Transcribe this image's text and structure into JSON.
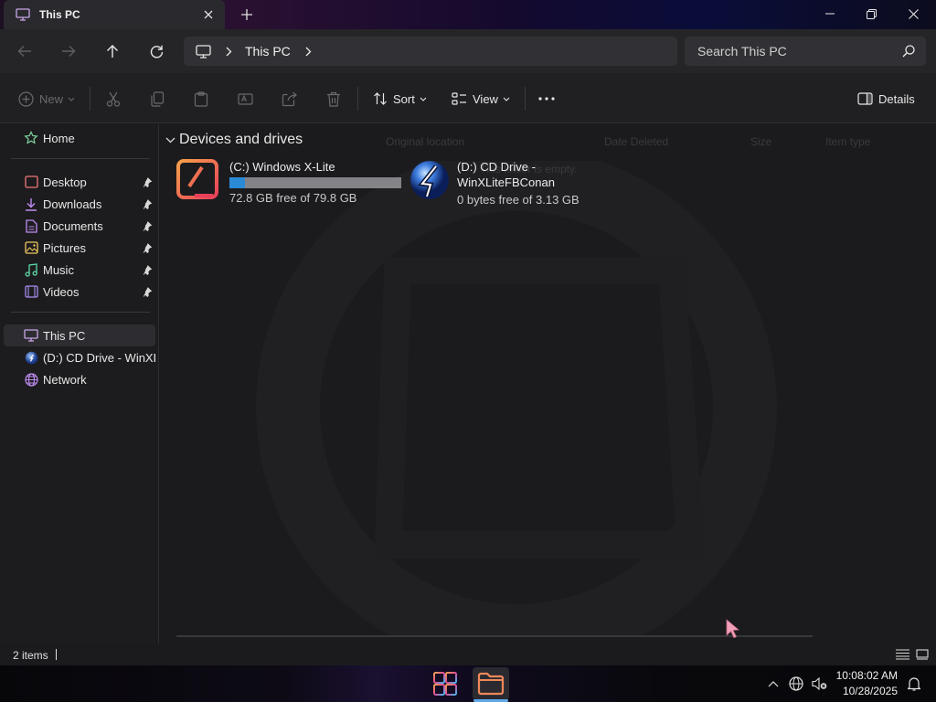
{
  "window": {
    "tab_title": "This PC",
    "tab_icon": "monitor-icon",
    "colors": {
      "accent": "#2b8ad6",
      "background": "#1b1b1d"
    }
  },
  "address": {
    "crumbs": [
      "This PC"
    ],
    "search_placeholder": "Search This PC"
  },
  "toolbar": {
    "new_label": "New",
    "sort_label": "Sort",
    "view_label": "View",
    "details_label": "Details"
  },
  "sidebar": {
    "home": {
      "label": "Home",
      "icon": "home-icon"
    },
    "pinned": [
      {
        "label": "Desktop",
        "icon": "desktop-icon",
        "pinned": true
      },
      {
        "label": "Downloads",
        "icon": "downloads-icon",
        "pinned": true
      },
      {
        "label": "Documents",
        "icon": "documents-icon",
        "pinned": true
      },
      {
        "label": "Pictures",
        "icon": "pictures-icon",
        "pinned": true
      },
      {
        "label": "Music",
        "icon": "music-icon",
        "pinned": true
      },
      {
        "label": "Videos",
        "icon": "videos-icon",
        "pinned": true
      }
    ],
    "locations": [
      {
        "label": "This PC",
        "icon": "this-pc-icon",
        "selected": true
      },
      {
        "label": "(D:) CD Drive - WinXLiteFBConan",
        "icon": "cd-drive-icon"
      },
      {
        "label": "Network",
        "icon": "network-icon"
      }
    ]
  },
  "content": {
    "group_header": "Devices and drives",
    "background_columns": [
      "Original location",
      "Date Deleted",
      "Size",
      "Item type"
    ],
    "background_empty_text": "This folder is empty.",
    "drives": [
      {
        "label": "(C:) Windows X-Lite",
        "free_text": "72.8 GB free of 79.8 GB",
        "used_fraction": 0.088,
        "icon": "windows-x-lite-drive-icon"
      },
      {
        "label_line1": "(D:) CD Drive -",
        "label_line2": "WinXLiteFBConan",
        "free_text": "0 bytes free of 3.13 GB",
        "icon": "cd-disc-icon"
      }
    ]
  },
  "status": {
    "item_count": "2 items"
  },
  "taskbar": {
    "time": "10:08:02 AM",
    "date": "10/28/2025"
  }
}
